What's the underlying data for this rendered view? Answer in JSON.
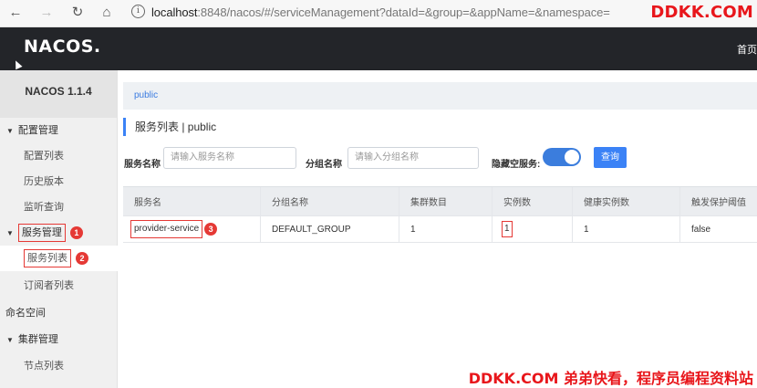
{
  "browser": {
    "url_host": "localhost",
    "url_rest": ":8848/nacos/#/serviceManagement?dataId=&group=&appName=&namespace=",
    "back_icon": "←",
    "forward_icon": "→",
    "reload_icon": "↻",
    "home_icon": "⌂",
    "info_icon": "i"
  },
  "watermark_top": "DDKK.COM",
  "watermark_bottom": "DDKK.COM 弟弟快看，程序员编程资料站",
  "app": {
    "logo_prefix": "NAC",
    "logo_mid": "O",
    "logo_suffix": "S.",
    "nav_home": "首页"
  },
  "sidebar": {
    "version": "NACOS 1.1.4",
    "items": [
      {
        "label": "配置管理",
        "kind": "group"
      },
      {
        "label": "配置列表",
        "kind": "sub"
      },
      {
        "label": "历史版本",
        "kind": "sub"
      },
      {
        "label": "监听查询",
        "kind": "sub"
      },
      {
        "label": "服务管理",
        "kind": "group",
        "badge": "1"
      },
      {
        "label": "服务列表",
        "kind": "sub",
        "badge": "2"
      },
      {
        "label": "订阅者列表",
        "kind": "sub"
      },
      {
        "label": "命名空间",
        "kind": "plain"
      },
      {
        "label": "集群管理",
        "kind": "group"
      },
      {
        "label": "节点列表",
        "kind": "sub"
      }
    ]
  },
  "main": {
    "namespace": "public",
    "title": "服务列表  |  public",
    "filters": {
      "service_label": "服务名称",
      "service_placeholder": "请输入服务名称",
      "group_label": "分组名称",
      "group_placeholder": "请输入分组名称",
      "hide_empty_label": "隐藏空服务:",
      "hide_empty_on": true,
      "query_label": "查询"
    },
    "table": {
      "columns": [
        "服务名",
        "分组名称",
        "集群数目",
        "实例数",
        "健康实例数",
        "触发保护阈值"
      ],
      "rows": [
        {
          "service": "provider-service",
          "badge": "3",
          "group": "DEFAULT_GROUP",
          "clusters": "1",
          "instances": "1",
          "healthy": "1",
          "protect": "false"
        }
      ]
    }
  },
  "colors": {
    "header_bg": "#232529",
    "accent": "#3b82f6",
    "annotation_red": "#e53935",
    "watermark_red": "#e8161b"
  }
}
